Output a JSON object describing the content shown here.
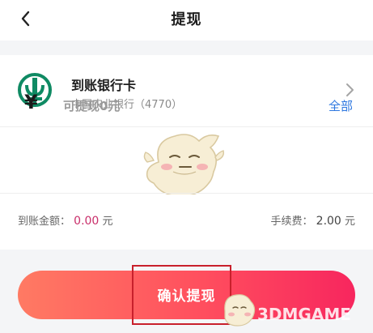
{
  "header": {
    "title": "提现",
    "back_icon": "chevron-left-icon"
  },
  "bank": {
    "title": "到账银行卡",
    "subtitle": "中国农业银行（4770）",
    "logo": "abc-bank-logo",
    "chevron_icon": "chevron-right-icon"
  },
  "amount": {
    "currency_symbol": "¥",
    "placeholder": "可提现0元",
    "all_label": "全部"
  },
  "summary": {
    "arrival_label": "到账金额：",
    "arrival_value": "0.00",
    "arrival_unit": "元",
    "fee_label": "手续费：",
    "fee_value": "2.00",
    "fee_unit": "元"
  },
  "confirm": {
    "label": "确认提现"
  },
  "watermark": {
    "text": "3DMGAME"
  },
  "colors": {
    "accent_blue": "#2f78e0",
    "amount_pink": "#c92e6a",
    "button_start": "#ff7a63",
    "button_end": "#f7265e",
    "bank_green": "#0f8a63",
    "highlight_red": "#c8202c"
  }
}
